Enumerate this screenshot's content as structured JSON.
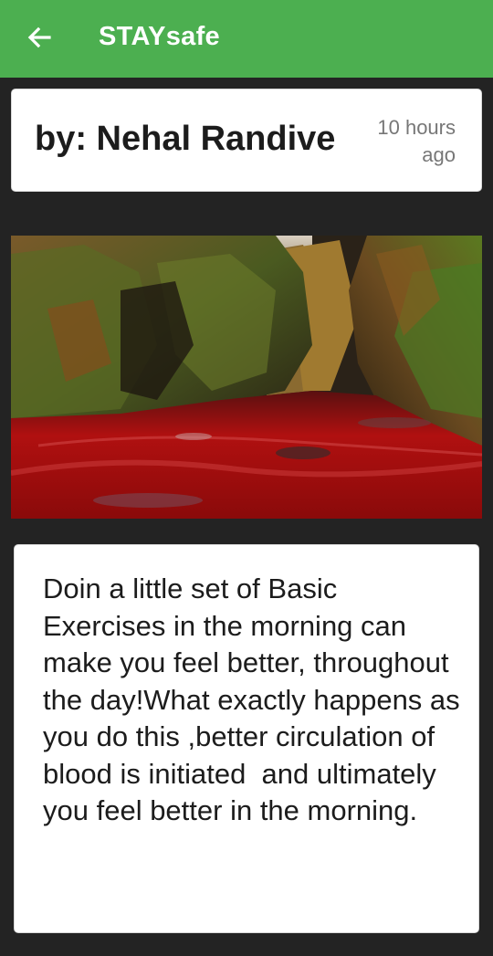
{
  "appbar": {
    "title": "STAYsafe",
    "back_icon": "arrow-left-icon",
    "color": "#4caf50"
  },
  "post": {
    "author": "by: Nehal Randive",
    "time_ago": "10 hours ago",
    "image": "red-river-canyon-photo",
    "body": "Doin a little set of Basic Exercises in the morning can make you feel better, throughout the day!What exactly happens as you do this ,better circulation of blood is initiated  and ultimately you feel better in the morning."
  }
}
